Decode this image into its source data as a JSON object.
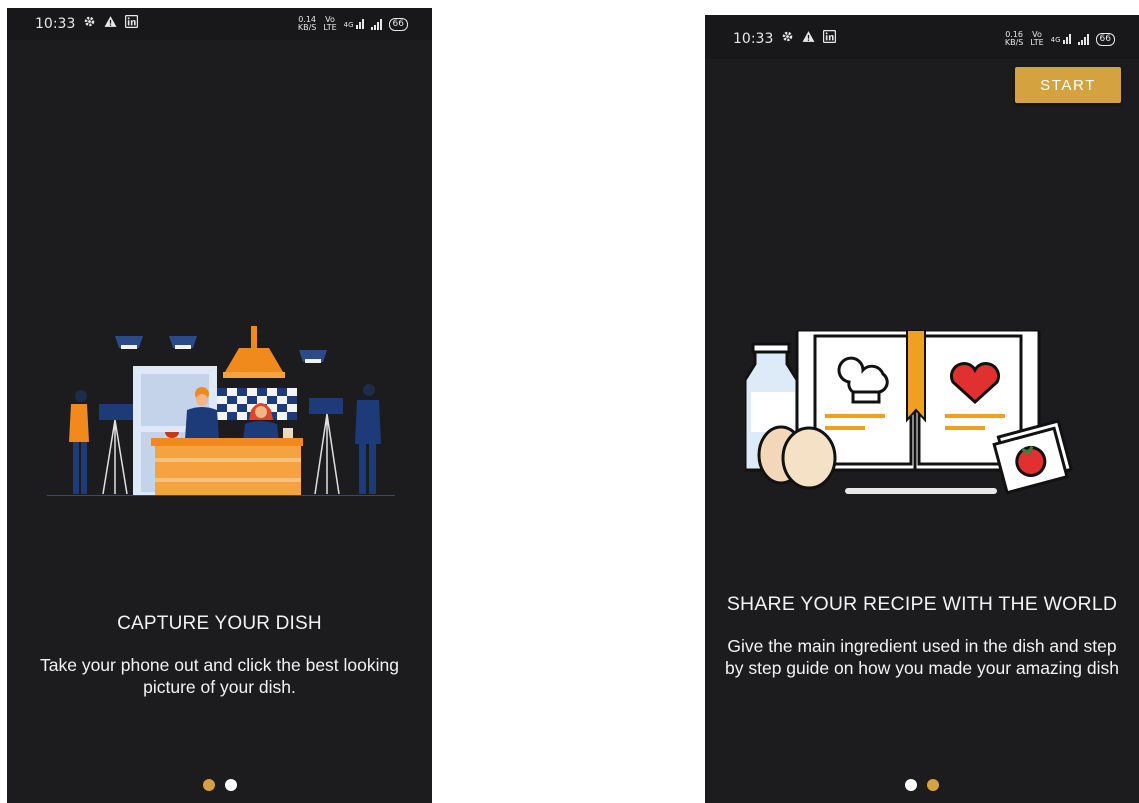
{
  "colors": {
    "background": "#1c1c1e",
    "accent": "#d4a23f",
    "dot_inactive": "#ffffff",
    "text": "#f2f2f2"
  },
  "left_screen": {
    "status": {
      "time": "10:33",
      "speed": "0.14\nKB/S",
      "net": "Vo\nLTE",
      "signal": "4G",
      "battery": "66"
    },
    "illustration": "cooking-show-filming-illustration",
    "title": "CAPTURE YOUR DISH",
    "description": "Take your phone out and click the best looking picture of your dish.",
    "active_page": 1
  },
  "right_screen": {
    "status": {
      "time": "10:33",
      "speed": "0.16\nKB/S",
      "net": "Vo\nLTE",
      "signal": "4G",
      "battery": "66"
    },
    "start_label": "START",
    "illustration": "recipe-book-illustration",
    "title": "SHARE YOUR RECIPE WITH THE WORLD",
    "description": "Give the main ingredient used in the dish and step by step guide on how you made your amazing dish",
    "active_page": 2
  }
}
